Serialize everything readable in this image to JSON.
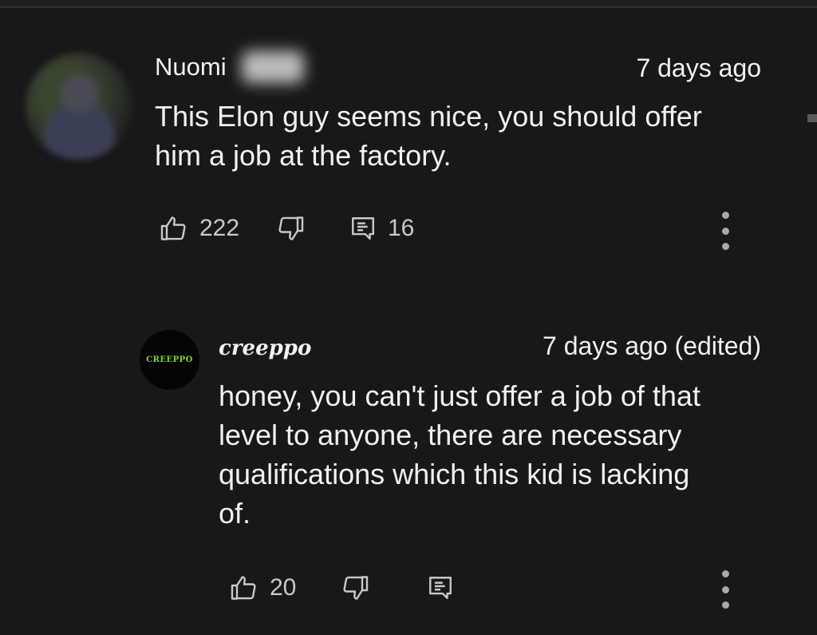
{
  "comments": [
    {
      "author": "Nuomi",
      "timestamp": "7 days ago",
      "text_lines": [
        "This Elon guy seems nice, you should offer",
        "him a job at the factory."
      ],
      "likes": "222",
      "replies": "16",
      "icons": [
        "like-icon",
        "dislike-icon",
        "reply-icon",
        "more-icon"
      ]
    },
    {
      "author": "creeppo",
      "avatar_label": "CREEPPO",
      "timestamp": "7 days ago (edited)",
      "text_lines": [
        "honey, you can't just offer a job of that",
        "level to anyone, there are necessary",
        "qualifications which this kid is lacking",
        "of."
      ],
      "likes": "20",
      "icons": [
        "like-icon",
        "dislike-icon",
        "reply-icon",
        "more-icon"
      ]
    }
  ],
  "colors": {
    "background": "#181818",
    "text": "#f1f1f1",
    "icon": "#a9a9a9",
    "avatar_logo": "#7fd13a"
  }
}
